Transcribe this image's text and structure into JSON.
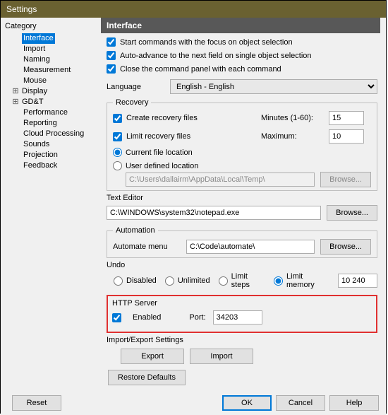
{
  "window": {
    "title": "Settings"
  },
  "left": {
    "category_label": "Category",
    "nodes": [
      {
        "label": "Interface",
        "indent": 1,
        "selected": true,
        "exp": ""
      },
      {
        "label": "Import",
        "indent": 1,
        "exp": ""
      },
      {
        "label": "Naming",
        "indent": 1,
        "exp": ""
      },
      {
        "label": "Measurement",
        "indent": 1,
        "exp": ""
      },
      {
        "label": "Mouse",
        "indent": 1,
        "exp": ""
      },
      {
        "label": "Display",
        "indent": 0,
        "exp": "⊞"
      },
      {
        "label": "GD&T",
        "indent": 0,
        "exp": "⊞"
      },
      {
        "label": "Performance",
        "indent": 1,
        "exp": ""
      },
      {
        "label": "Reporting",
        "indent": 1,
        "exp": ""
      },
      {
        "label": "Cloud Processing",
        "indent": 1,
        "exp": ""
      },
      {
        "label": "Sounds",
        "indent": 1,
        "exp": ""
      },
      {
        "label": "Projection",
        "indent": 1,
        "exp": ""
      },
      {
        "label": "Feedback",
        "indent": 1,
        "exp": ""
      }
    ]
  },
  "panel": {
    "title": "Interface",
    "chk_start": "Start commands with the focus on object selection",
    "chk_auto": "Auto-advance to the next field on single object selection",
    "chk_close": "Close the command panel with each command",
    "language_label": "Language",
    "language_value": "English - English",
    "recovery": {
      "legend": "Recovery",
      "create_label": "Create recovery files",
      "minutes_label": "Minutes (1-60):",
      "minutes_value": "15",
      "limit_label": "Limit recovery files",
      "max_label": "Maximum:",
      "max_value": "10",
      "current_loc": "Current file location",
      "user_loc": "User defined location",
      "path": "C:\\Users\\dallairm\\AppData\\Local\\Temp\\",
      "browse": "Browse..."
    },
    "texteditor": {
      "legend": "Text Editor",
      "path": "C:\\WINDOWS\\system32\\notepad.exe",
      "browse": "Browse..."
    },
    "automation": {
      "legend": "Automation",
      "menu_label": "Automate menu",
      "path": "C:\\Code\\automate\\",
      "browse": "Browse..."
    },
    "undo": {
      "legend": "Undo",
      "disabled": "Disabled",
      "unlimited": "Unlimited",
      "limit_steps": "Limit steps",
      "limit_memory": "Limit memory",
      "value": "10 240"
    },
    "http": {
      "legend": "HTTP Server",
      "enabled": "Enabled",
      "port_label": "Port:",
      "port_value": "34203"
    },
    "ie": {
      "legend": "Import/Export Settings",
      "export": "Export",
      "import": "Import"
    },
    "restore": "Restore Defaults"
  },
  "footer": {
    "reset": "Reset",
    "ok": "OK",
    "cancel": "Cancel",
    "help": "Help"
  }
}
